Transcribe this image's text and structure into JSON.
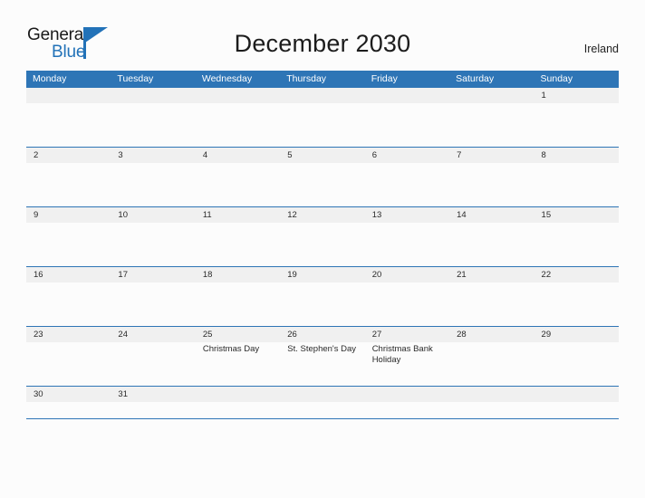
{
  "brand": {
    "name_part1": "General",
    "name_part2": "Blue",
    "flag_icon": "blue-triangle-flag-icon",
    "primary_color": "#2272b8"
  },
  "header": {
    "title": "December 2030",
    "country": "Ireland"
  },
  "calendar": {
    "header_color": "#2e75b6",
    "date_strip_color": "#f0f0f0",
    "weekdays": [
      "Monday",
      "Tuesday",
      "Wednesday",
      "Thursday",
      "Friday",
      "Saturday",
      "Sunday"
    ],
    "weeks": [
      {
        "days": [
          {
            "num": "",
            "events": []
          },
          {
            "num": "",
            "events": []
          },
          {
            "num": "",
            "events": []
          },
          {
            "num": "",
            "events": []
          },
          {
            "num": "",
            "events": []
          },
          {
            "num": "",
            "events": []
          },
          {
            "num": "1",
            "events": []
          }
        ]
      },
      {
        "days": [
          {
            "num": "2",
            "events": []
          },
          {
            "num": "3",
            "events": []
          },
          {
            "num": "4",
            "events": []
          },
          {
            "num": "5",
            "events": []
          },
          {
            "num": "6",
            "events": []
          },
          {
            "num": "7",
            "events": []
          },
          {
            "num": "8",
            "events": []
          }
        ]
      },
      {
        "days": [
          {
            "num": "9",
            "events": []
          },
          {
            "num": "10",
            "events": []
          },
          {
            "num": "11",
            "events": []
          },
          {
            "num": "12",
            "events": []
          },
          {
            "num": "13",
            "events": []
          },
          {
            "num": "14",
            "events": []
          },
          {
            "num": "15",
            "events": []
          }
        ]
      },
      {
        "days": [
          {
            "num": "16",
            "events": []
          },
          {
            "num": "17",
            "events": []
          },
          {
            "num": "18",
            "events": []
          },
          {
            "num": "19",
            "events": []
          },
          {
            "num": "20",
            "events": []
          },
          {
            "num": "21",
            "events": []
          },
          {
            "num": "22",
            "events": []
          }
        ]
      },
      {
        "days": [
          {
            "num": "23",
            "events": []
          },
          {
            "num": "24",
            "events": []
          },
          {
            "num": "25",
            "events": [
              "Christmas Day"
            ]
          },
          {
            "num": "26",
            "events": [
              "St. Stephen's Day"
            ]
          },
          {
            "num": "27",
            "events": [
              "Christmas Bank Holiday"
            ]
          },
          {
            "num": "28",
            "events": []
          },
          {
            "num": "29",
            "events": []
          }
        ]
      },
      {
        "short": true,
        "days": [
          {
            "num": "30",
            "events": []
          },
          {
            "num": "31",
            "events": []
          },
          {
            "num": "",
            "events": []
          },
          {
            "num": "",
            "events": []
          },
          {
            "num": "",
            "events": []
          },
          {
            "num": "",
            "events": []
          },
          {
            "num": "",
            "events": []
          }
        ]
      }
    ]
  }
}
